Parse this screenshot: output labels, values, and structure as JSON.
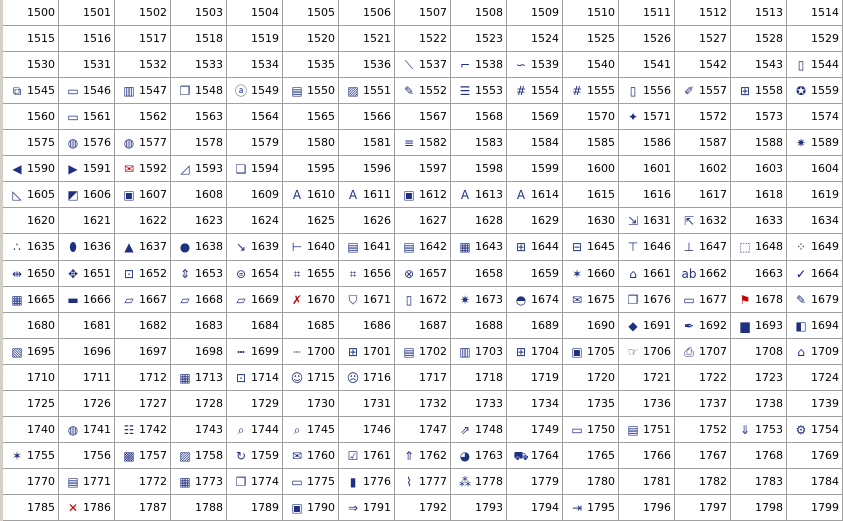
{
  "grid": {
    "start": 1500,
    "columns": 15,
    "rows": 20,
    "icons": {
      "1537": "connector-straight-icon",
      "1538": "connector-elbow-icon",
      "1539": "connector-curved-icon",
      "1544": "blank-page-icon",
      "1545": "copy-shape-icon",
      "1546": "label-icon",
      "1547": "chart-page-icon",
      "1548": "stacked-pages-icon",
      "1549": "field-a-icon",
      "1550": "table-icon",
      "1551": "picture-icon",
      "1552": "pencil-icon",
      "1553": "list-icon",
      "1554": "number-field-icon",
      "1555": "number-field-2-icon",
      "1556": "page-icon",
      "1557": "form-edit-icon",
      "1558": "add-box-icon",
      "1559": "query-wizard-icon",
      "1561": "monitor-icon",
      "1571": "builder-icon",
      "1576": "globe-icon",
      "1577": "globe-link-icon",
      "1582": "lines-icon",
      "1589": "folder-star-icon",
      "1590": "arrow-left-icon",
      "1591": "arrow-right-icon",
      "1592": "envelope-x-icon",
      "1593": "scale-icon",
      "1594": "two-windows-icon",
      "1605": "ruler-icon",
      "1606": "select-icon",
      "1607": "form-icon",
      "1610": "abc-icon",
      "1611": "abc-spark-icon",
      "1612": "frame-icon",
      "1613": "abc-a-icon",
      "1614": "abc-text-icon",
      "1631": "import-icon",
      "1632": "export-icon",
      "1635": "dots-icon",
      "1636": "cylinder-icon",
      "1637": "triangle-icon",
      "1638": "drop-icon",
      "1639": "diagonal-arrow-icon",
      "1640": "door-icon",
      "1641": "page-list-icon",
      "1642": "page-lines-icon",
      "1643": "truck-icon",
      "1644": "center-align-icon",
      "1645": "space-equal-icon",
      "1646": "align-top-icon",
      "1647": "align-middle-icon",
      "1648": "dashed-box-icon",
      "1649": "grid-dots-icon",
      "1650": "spread-icon",
      "1651": "move-icon",
      "1652": "group-icon",
      "1653": "vertical-move-icon",
      "1654": "stack-icon",
      "1655": "snap-icon",
      "1656": "snap-2-icon",
      "1657": "search-x-icon",
      "1660": "sparkle-icon",
      "1661": "open-folder-icon",
      "1662": "spell-icon",
      "1664": "check-icon",
      "1665": "save-disk-icon",
      "1666": "dash-tool-icon",
      "1667": "folder-icon",
      "1668": "folder-delete-icon",
      "1669": "folder-dotted-icon",
      "1670": "delete-icon",
      "1671": "shield-icon",
      "1672": "book-icon",
      "1673": "star-list-icon",
      "1674": "dome-icon",
      "1675": "mail-icon",
      "1676": "windows-copy-icon",
      "1677": "card-icon",
      "1678": "flag-icon",
      "1679": "page-edit-icon",
      "1691": "paint-icon",
      "1692": "pen-line-icon",
      "1693": "computer-icon",
      "1694": "eraser-icon",
      "1695": "window-image-icon",
      "1699": "ruler-dots-icon",
      "1700": "ruler-lines-icon",
      "1701": "grid-small-icon",
      "1702": "grid-rows-icon",
      "1703": "grid-cols-icon",
      "1704": "table-cross-icon",
      "1705": "frame-dark-icon",
      "1706": "hand-page-icon",
      "1707": "printer-icon",
      "1709": "home-page-icon",
      "1713": "film-icon",
      "1714": "screen-zoom-icon",
      "1715": "people-icon",
      "1716": "people-x-icon",
      "1741": "globe-stand-icon",
      "1742": "list-box-icon",
      "1744": "page-search-icon",
      "1745": "magnifier-icon",
      "1748": "page-arrow-icon",
      "1750": "window-icon",
      "1751": "note-icon",
      "1753": "page-download-icon",
      "1754": "gear-link-icon",
      "1755": "star-page-icon",
      "1757": "package-icon",
      "1758": "notepad-icon",
      "1759": "refresh-icon",
      "1760": "mail-edit-icon",
      "1761": "clipboard-check-icon",
      "1762": "folder-up-icon",
      "1763": "color-wheel-icon",
      "1764": "truck-2-icon",
      "1771": "books-icon",
      "1773": "calculator-icon",
      "1774": "windows-stack-icon",
      "1775": "id-card-icon",
      "1776": "book-green-icon",
      "1777": "scroll-icon",
      "1778": "network-icon",
      "1786": "close-icon",
      "1790": "floppy-icon",
      "1791": "folder-open-arrow-icon",
      "1795": "arrow-bar-icon"
    },
    "glyphs": {
      "connector-straight-icon": "⟍",
      "connector-elbow-icon": "⌐",
      "connector-curved-icon": "∽",
      "blank-page-icon": "▯",
      "copy-shape-icon": "⧉",
      "label-icon": "▭",
      "chart-page-icon": "▥",
      "stacked-pages-icon": "❐",
      "field-a-icon": "ⓐ",
      "table-icon": "▤",
      "picture-icon": "▨",
      "pencil-icon": "✎",
      "list-icon": "☰",
      "number-field-icon": "#",
      "number-field-2-icon": "#",
      "page-icon": "▯",
      "form-edit-icon": "✐",
      "add-box-icon": "⊞",
      "query-wizard-icon": "✪",
      "monitor-icon": "▭",
      "builder-icon": "✦",
      "globe-icon": "◍",
      "globe-link-icon": "◍",
      "lines-icon": "≡",
      "folder-star-icon": "✷",
      "arrow-left-icon": "◀",
      "arrow-right-icon": "▶",
      "envelope-x-icon": "✉",
      "scale-icon": "◿",
      "two-windows-icon": "❏",
      "ruler-icon": "◺",
      "select-icon": "◩",
      "form-icon": "▣",
      "abc-icon": "A",
      "abc-spark-icon": "A",
      "frame-icon": "▣",
      "abc-a-icon": "A",
      "abc-text-icon": "A",
      "import-icon": "⇲",
      "export-icon": "⇱",
      "dots-icon": "∴",
      "cylinder-icon": "⬮",
      "triangle-icon": "▲",
      "drop-icon": "●",
      "diagonal-arrow-icon": "↘",
      "door-icon": "⊢",
      "page-list-icon": "▤",
      "page-lines-icon": "▤",
      "truck-icon": "▦",
      "center-align-icon": "⊞",
      "space-equal-icon": "⊟",
      "align-top-icon": "⊤",
      "align-middle-icon": "⊥",
      "dashed-box-icon": "⬚",
      "grid-dots-icon": "⁘",
      "spread-icon": "⇹",
      "move-icon": "✥",
      "group-icon": "⊡",
      "vertical-move-icon": "⇕",
      "stack-icon": "⊜",
      "snap-icon": "⌗",
      "snap-2-icon": "⌗",
      "search-x-icon": "⊗",
      "sparkle-icon": "✶",
      "open-folder-icon": "⌂",
      "spell-icon": "ab",
      "check-icon": "✓",
      "save-disk-icon": "▦",
      "dash-tool-icon": "▬",
      "folder-icon": "▱",
      "folder-delete-icon": "▱",
      "folder-dotted-icon": "▱",
      "delete-icon": "✗",
      "shield-icon": "⛉",
      "book-icon": "▯",
      "star-list-icon": "✷",
      "dome-icon": "◓",
      "mail-icon": "✉",
      "windows-copy-icon": "❐",
      "card-icon": "▭",
      "flag-icon": "⚑",
      "page-edit-icon": "✎",
      "paint-icon": "◆",
      "pen-line-icon": "✒",
      "computer-icon": "▆",
      "eraser-icon": "◧",
      "window-image-icon": "▧",
      "ruler-dots-icon": "┅",
      "ruler-lines-icon": "┄",
      "grid-small-icon": "⊞",
      "grid-rows-icon": "▤",
      "grid-cols-icon": "▥",
      "table-cross-icon": "⊞",
      "frame-dark-icon": "▣",
      "hand-page-icon": "☞",
      "printer-icon": "⎙",
      "home-page-icon": "⌂",
      "film-icon": "▦",
      "screen-zoom-icon": "⊡",
      "people-icon": "☺",
      "people-x-icon": "☹",
      "globe-stand-icon": "◍",
      "list-box-icon": "☷",
      "page-search-icon": "⌕",
      "magnifier-icon": "⌕",
      "page-arrow-icon": "⇗",
      "window-icon": "▭",
      "note-icon": "▤",
      "page-download-icon": "⇓",
      "gear-link-icon": "⚙",
      "star-page-icon": "✶",
      "package-icon": "▩",
      "notepad-icon": "▨",
      "refresh-icon": "↻",
      "mail-edit-icon": "✉",
      "clipboard-check-icon": "☑",
      "folder-up-icon": "⇑",
      "color-wheel-icon": "◕",
      "truck-2-icon": "⛟",
      "books-icon": "▤",
      "calculator-icon": "▦",
      "windows-stack-icon": "❐",
      "id-card-icon": "▭",
      "book-green-icon": "▮",
      "scroll-icon": "⌇",
      "network-icon": "⁂",
      "close-icon": "✕",
      "floppy-icon": "▣",
      "folder-open-arrow-icon": "⇒",
      "arrow-bar-icon": "⇥"
    },
    "colors": {
      "cell_background": "#ffffff",
      "grid_line": "#a0a0a0",
      "window_background": "#d4d0c8",
      "icon_default": "#203080",
      "close_icon": "#c00000",
      "check_icon": "#000080",
      "flag_icon": "#c00000"
    }
  }
}
